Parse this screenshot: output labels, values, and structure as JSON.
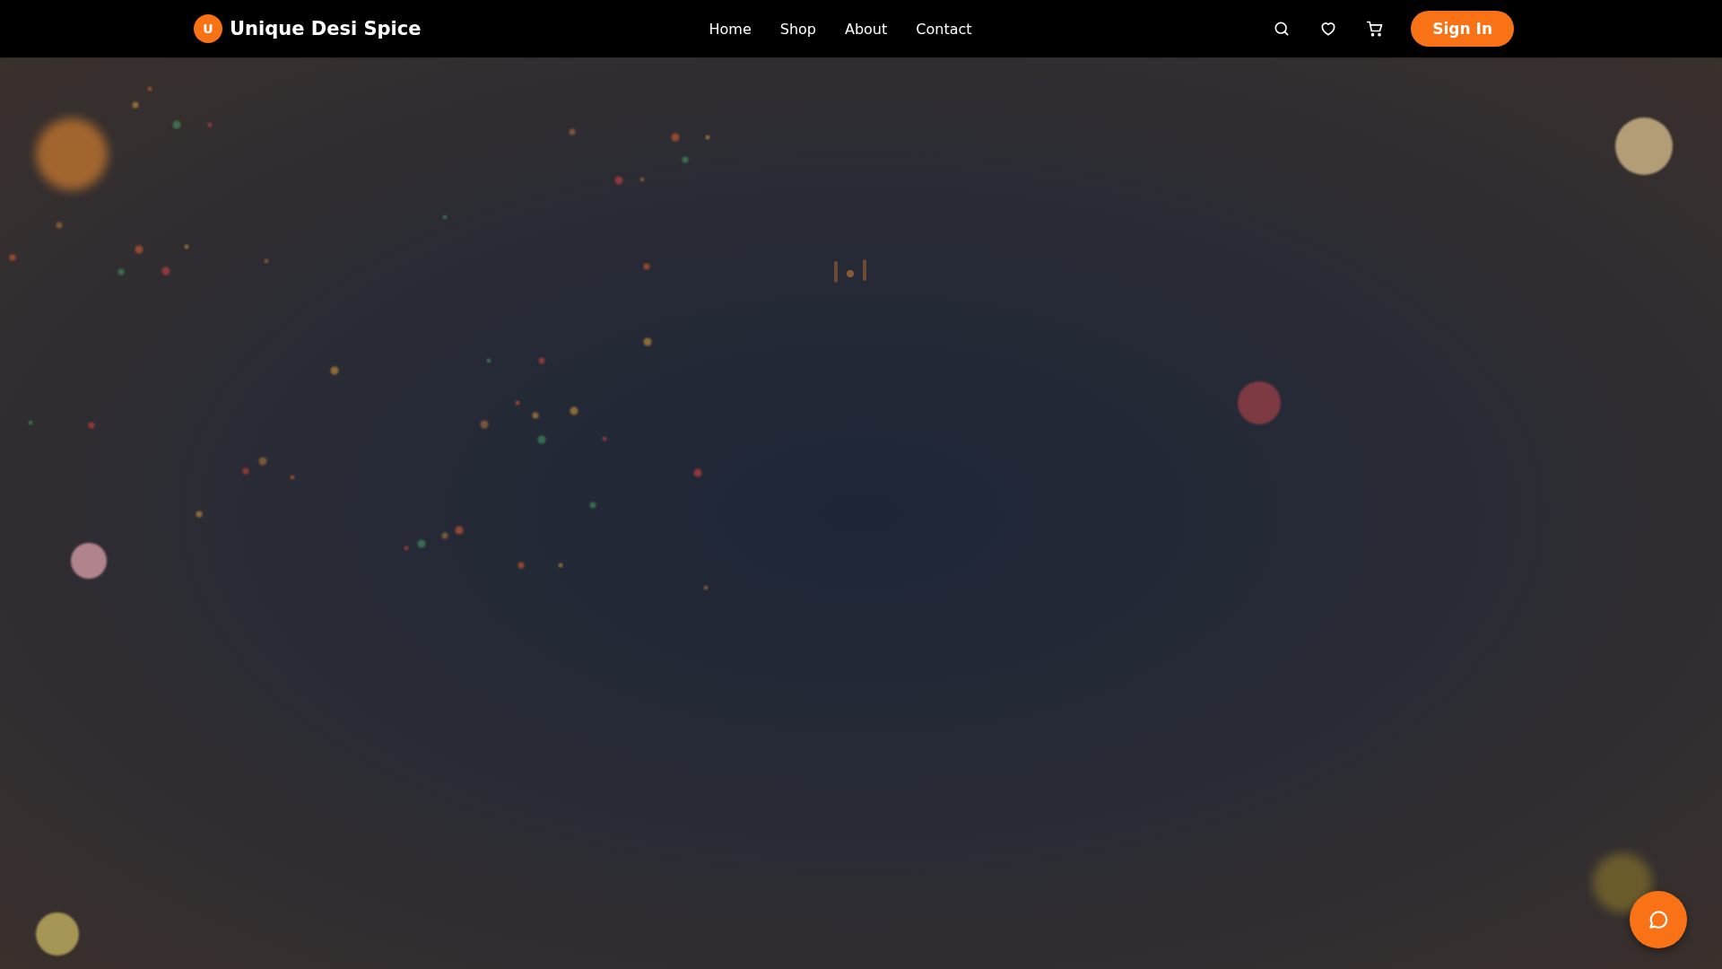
{
  "brand": {
    "initial": "U",
    "name": "Unique Desi Spice"
  },
  "nav": [
    {
      "label": "Home"
    },
    {
      "label": "Shop"
    },
    {
      "label": "About"
    },
    {
      "label": "Contact"
    }
  ],
  "sign_in": "Sign In"
}
